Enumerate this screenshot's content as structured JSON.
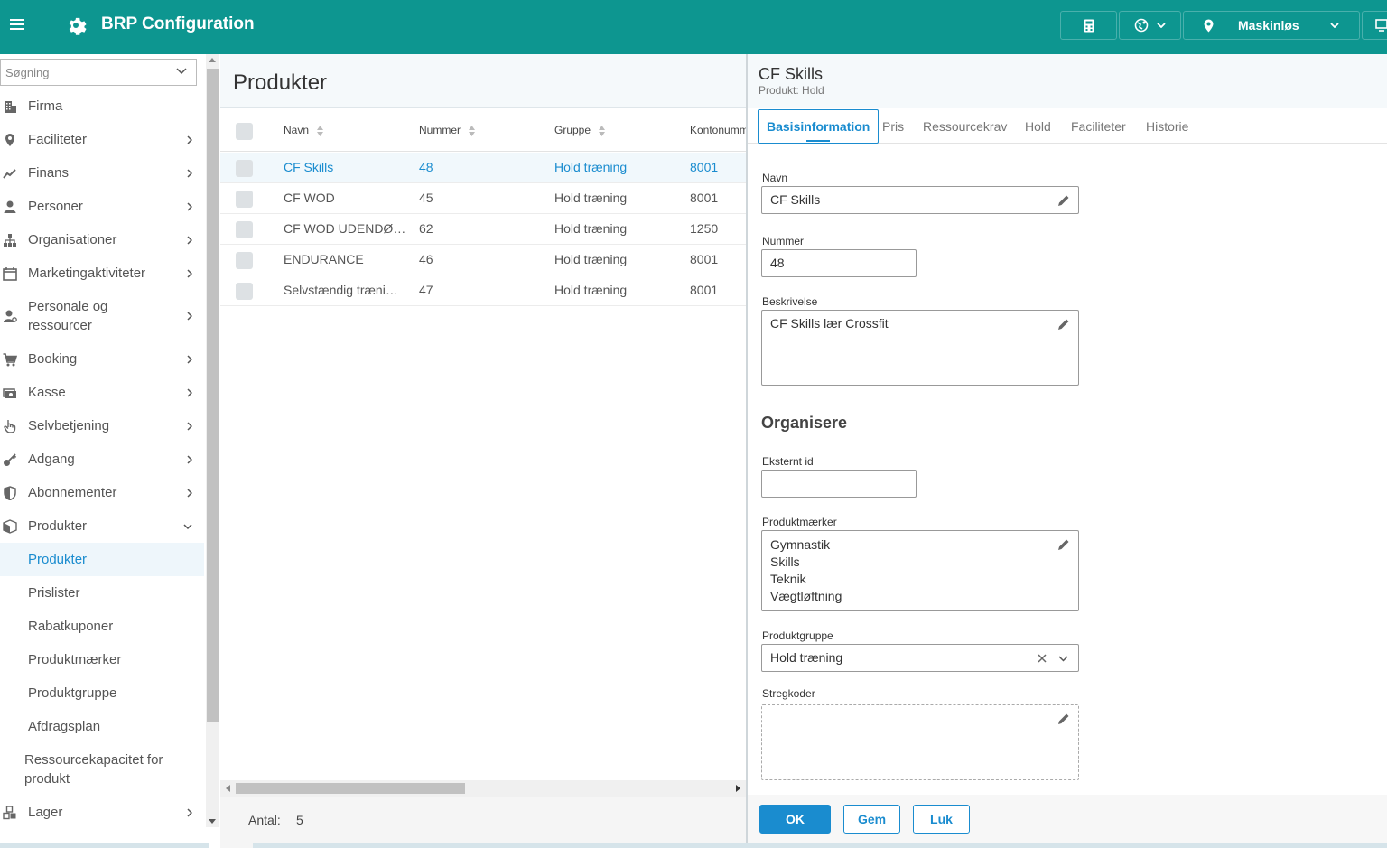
{
  "app": {
    "title": "BRP Configuration"
  },
  "topbar": {
    "location_label": "Maskinløs"
  },
  "sidebar": {
    "search_placeholder": "Søgning",
    "items": [
      {
        "label": "Firma",
        "icon": "building-icon",
        "has_arrow": false
      },
      {
        "label": "Faciliteter",
        "icon": "location-pin-icon",
        "has_arrow": true
      },
      {
        "label": "Finans",
        "icon": "trend-line-icon",
        "has_arrow": true
      },
      {
        "label": "Personer",
        "icon": "person-icon",
        "has_arrow": true
      },
      {
        "label": "Organisationer",
        "icon": "org-chart-icon",
        "has_arrow": true
      },
      {
        "label": "Marketingaktiviteter",
        "icon": "calendar-icon",
        "has_arrow": true
      },
      {
        "label": "Personale og ressourcer",
        "icon": "staff-icon",
        "has_arrow": true
      },
      {
        "label": "Booking",
        "icon": "cart-icon",
        "has_arrow": true
      },
      {
        "label": "Kasse",
        "icon": "cash-icon",
        "has_arrow": true
      },
      {
        "label": "Selvbetjening",
        "icon": "hand-pointer-icon",
        "has_arrow": true
      },
      {
        "label": "Adgang",
        "icon": "key-icon",
        "has_arrow": true
      },
      {
        "label": "Abonnementer",
        "icon": "shield-icon",
        "has_arrow": true
      },
      {
        "label": "Produkter",
        "icon": "box-icon",
        "has_arrow": true,
        "expanded": true
      }
    ],
    "sub_items": [
      {
        "label": "Produkter",
        "active": true
      },
      {
        "label": "Prislister"
      },
      {
        "label": "Rabatkuponer"
      },
      {
        "label": "Produktmærker"
      },
      {
        "label": "Produktgruppe"
      },
      {
        "label": "Afdragsplan"
      },
      {
        "label": "Ressourcekapacitet for produkt"
      }
    ],
    "after_items": [
      {
        "label": "Lager",
        "icon": "boxes-icon",
        "has_arrow": true
      }
    ]
  },
  "main": {
    "title": "Produkter",
    "columns": [
      "Navn",
      "Nummer",
      "Gruppe",
      "Kontonummer"
    ],
    "rows": [
      {
        "navn": "CF Skills",
        "nummer": "48",
        "gruppe": "Hold træning",
        "konto": "8001",
        "selected": true
      },
      {
        "navn": "CF WOD",
        "nummer": "45",
        "gruppe": "Hold træning",
        "konto": "8001"
      },
      {
        "navn": "CF WOD UDENDØ…",
        "nummer": "62",
        "gruppe": "Hold træning",
        "konto": "1250"
      },
      {
        "navn": "ENDURANCE",
        "nummer": "46",
        "gruppe": "Hold træning",
        "konto": "8001"
      },
      {
        "navn": "Selvstændig træni…",
        "nummer": "47",
        "gruppe": "Hold træning",
        "konto": "8001"
      }
    ],
    "footer": {
      "count_label": "Antal:",
      "count_value": "5"
    }
  },
  "panel": {
    "title": "CF Skills",
    "subtitle": "Produkt: Hold",
    "tabs": [
      "Basisinformation",
      "Pris",
      "Ressourcekrav",
      "Hold",
      "Faciliteter",
      "Historie"
    ],
    "fields": {
      "navn_label": "Navn",
      "navn_value": "CF Skills",
      "nummer_label": "Nummer",
      "nummer_value": "48",
      "beskrivelse_label": "Beskrivelse",
      "beskrivelse_value": "CF Skills lær Crossfit",
      "section_title": "Organisere",
      "eksternt_id_label": "Eksternt id",
      "eksternt_id_value": "",
      "produktmaerker_label": "Produktmærker",
      "produktmaerker_values": [
        "Gymnastik",
        "Skills",
        "Teknik",
        "Vægtløftning"
      ],
      "produktgruppe_label": "Produktgruppe",
      "produktgruppe_value": "Hold træning",
      "stregkoder_label": "Stregkoder"
    },
    "buttons": {
      "ok": "OK",
      "save": "Gem",
      "close": "Luk"
    }
  },
  "colors": {
    "brand": "#0d9690",
    "accent": "#1a8ccf"
  }
}
